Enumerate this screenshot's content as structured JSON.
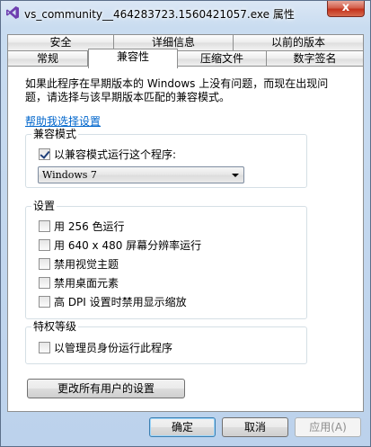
{
  "window": {
    "title": "vs_community__464283723.1560421057.exe 属性",
    "close_label": "x"
  },
  "tabs": {
    "row_back": [
      {
        "label": "安全"
      },
      {
        "label": "详细信息"
      },
      {
        "label": "以前的版本"
      }
    ],
    "row_front": [
      {
        "label": "常规"
      },
      {
        "label": "兼容性",
        "active": true
      },
      {
        "label": "压缩文件"
      },
      {
        "label": "数字签名"
      }
    ]
  },
  "compat": {
    "description": "如果此程序在早期版本的 Windows 上没有问题，而现在出现问题，请选择与该早期版本匹配的兼容模式。",
    "help_link": "帮助我选择设置",
    "mode_group": {
      "title": "兼容模式",
      "run_in_compat_label": "以兼容模式运行这个程序:",
      "run_in_compat_checked": true,
      "selected_os": "Windows 7"
    },
    "settings_group": {
      "title": "设置",
      "items": [
        {
          "label": "用 256 色运行",
          "checked": false
        },
        {
          "label": "用 640 x 480 屏幕分辨率运行",
          "checked": false
        },
        {
          "label": "禁用视觉主题",
          "checked": false
        },
        {
          "label": "禁用桌面元素",
          "checked": false
        },
        {
          "label": "高 DPI 设置时禁用显示缩放",
          "checked": false
        }
      ]
    },
    "privilege_group": {
      "title": "特权等级",
      "admin_label": "以管理员身份运行此程序",
      "admin_checked": false
    },
    "change_all_users_button": "更改所有用户的设置"
  },
  "footer": {
    "ok_label": "确定",
    "cancel_label": "取消",
    "apply_label": "应用(A)"
  }
}
